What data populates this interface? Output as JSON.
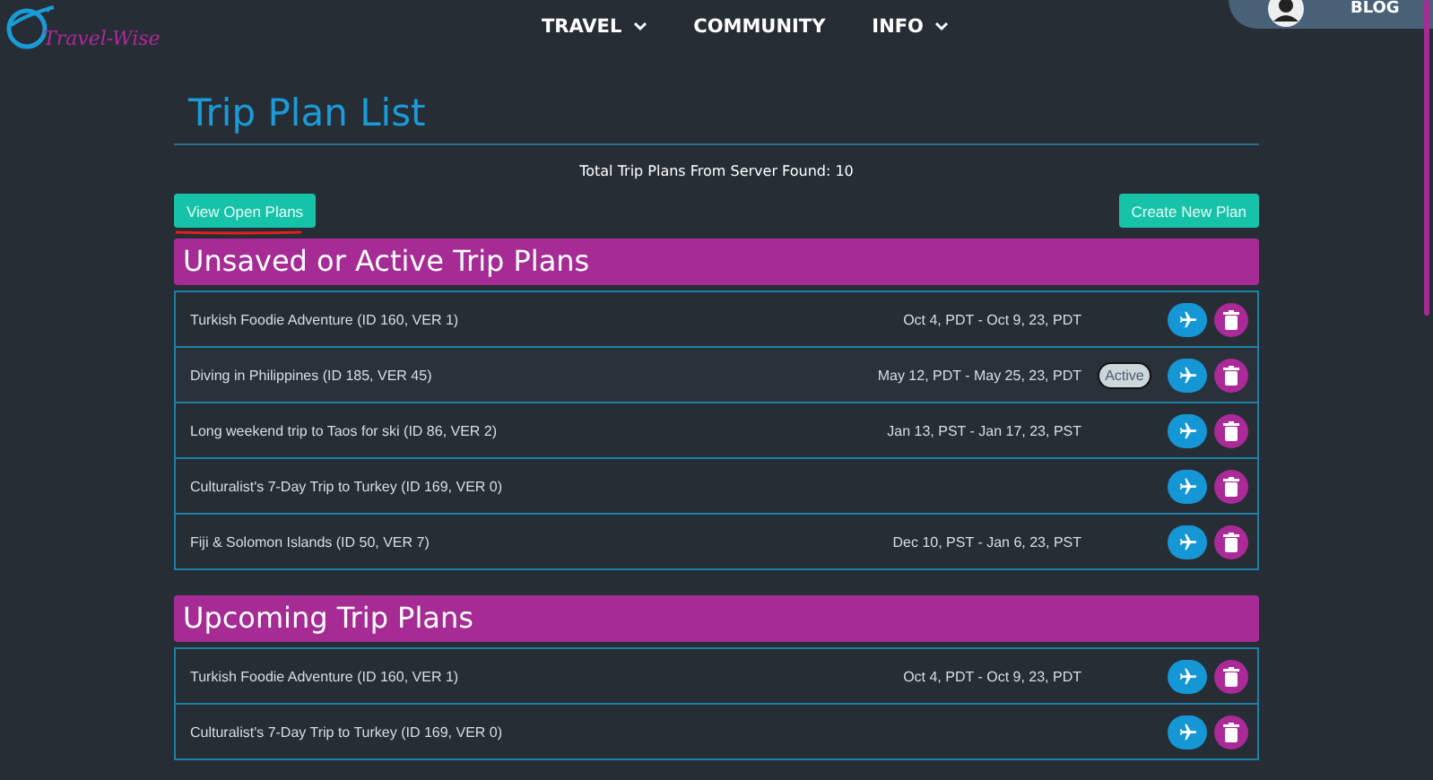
{
  "nav": {
    "logo": "Travel-Wise",
    "items": [
      {
        "label": "TRAVEL",
        "dropdown": true
      },
      {
        "label": "COMMUNITY",
        "dropdown": false
      },
      {
        "label": "INFO",
        "dropdown": true
      }
    ],
    "blog": "BLOG"
  },
  "page": {
    "title": "Trip Plan List",
    "total": "Total Trip Plans From Server Found: 10",
    "view_button": "View Open Plans",
    "create_button": "Create New Plan"
  },
  "sections": [
    {
      "title": "Unsaved or Active Trip Plans",
      "rows": [
        {
          "name": "Turkish Foodie Adventure (ID 160, VER 1)",
          "dates": "Oct 4, PDT - Oct 9, 23, PDT",
          "active": false
        },
        {
          "name": "Diving in Philippines (ID 185, VER 45)",
          "dates": "May 12, PDT - May 25, 23, PDT",
          "active": true,
          "badge": "Active"
        },
        {
          "name": "Long weekend trip to Taos for ski (ID 86, VER 2)",
          "dates": "Jan 13, PST - Jan 17, 23, PST",
          "active": false
        },
        {
          "name": "Culturalist's 7-Day Trip to Turkey (ID 169, VER 0)",
          "active": false
        },
        {
          "name": "Fiji & Solomon Islands (ID 50, VER 7)",
          "dates": "Dec 10, PST - Jan 6, 23, PST",
          "active": false
        }
      ]
    },
    {
      "title": "Upcoming Trip Plans",
      "rows": [
        {
          "name": "Turkish Foodie Adventure (ID 160, VER 1)",
          "dates": "Oct 4, PDT - Oct 9, 23, PDT",
          "active": false
        },
        {
          "name": "Culturalist's 7-Day Trip to Turkey (ID 169, VER 0)",
          "active": false
        }
      ]
    }
  ]
}
